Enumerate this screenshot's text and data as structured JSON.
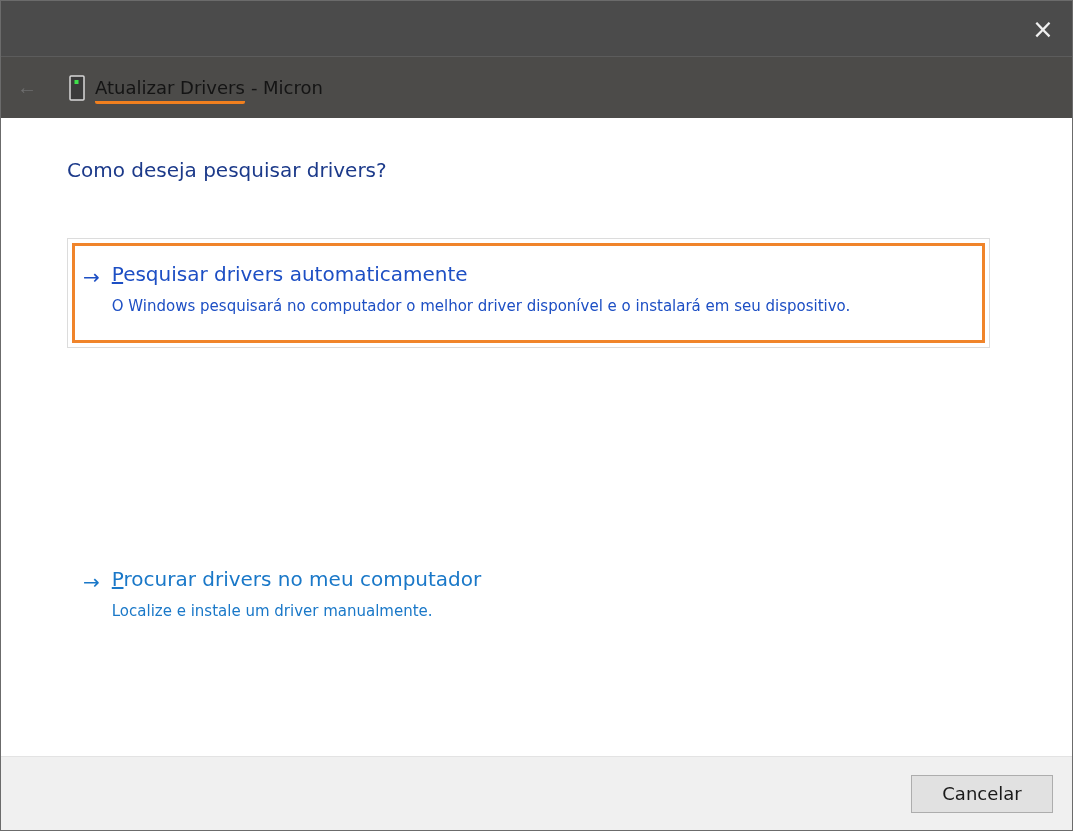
{
  "window": {
    "close": "×"
  },
  "header": {
    "back": "←",
    "title": "Atualizar Drivers",
    "title_underlined": true,
    "title_suffix": "- Micron"
  },
  "heading": "Como deseja pesquisar drivers?",
  "options": [
    {
      "arrow": "→",
      "title": "Pesquisar drivers automaticamente",
      "description": "O Windows pesquisará no computador o melhor driver disponível e o instalará em seu dispositivo.",
      "selected": true
    },
    {
      "arrow": "→",
      "title": "Procurar drivers no meu computador",
      "description": "Localize e instale um driver manualmente.",
      "selected": false
    }
  ],
  "buttons": [
    "Cancelar"
  ]
}
